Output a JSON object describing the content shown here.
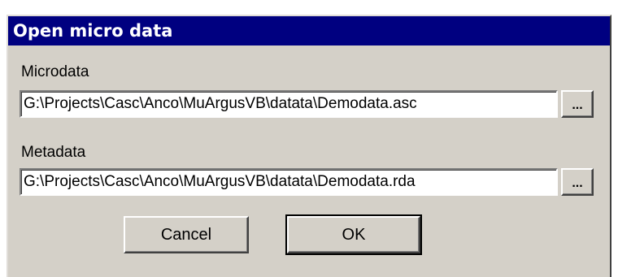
{
  "window": {
    "title": "Open micro data"
  },
  "microdata": {
    "label": "Microdata",
    "path": "G:\\Projects\\Casc\\Anco\\MuArgusVB\\datata\\Demodata.asc",
    "browse_label": "..."
  },
  "metadata": {
    "label": "Metadata",
    "path": "G:\\Projects\\Casc\\Anco\\MuArgusVB\\datata\\Demodata.rda",
    "browse_label": "..."
  },
  "buttons": {
    "cancel_label": "Cancel",
    "ok_label": "OK"
  }
}
